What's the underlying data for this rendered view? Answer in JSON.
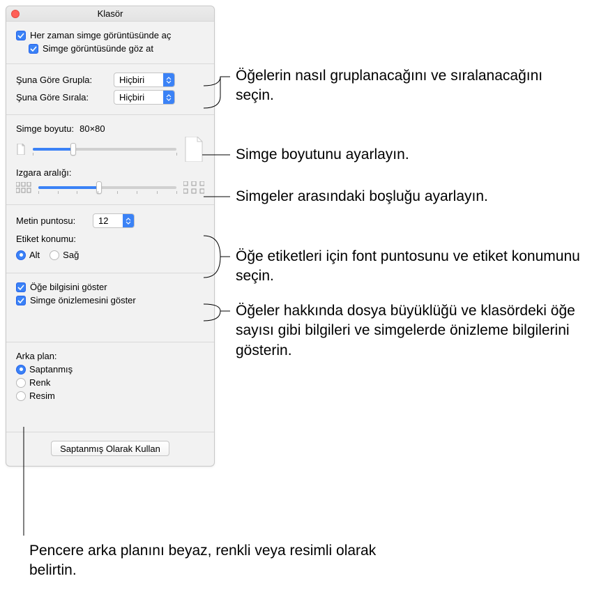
{
  "window": {
    "title": "Klasör"
  },
  "top": {
    "always_icon_view": "Her zaman simge görüntüsünde aç",
    "browse_icon_view": "Simge görüntüsünde göz at"
  },
  "group": {
    "group_by_label": "Şuna Göre Grupla:",
    "group_by_value": "Hiçbiri",
    "sort_by_label": "Şuna Göre Sırala:",
    "sort_by_value": "Hiçbiri"
  },
  "size": {
    "icon_size_label": "Simge boyutu:",
    "icon_size_value": "80×80",
    "grid_spacing_label": "Izgara aralığı:"
  },
  "text": {
    "text_size_label": "Metin puntosu:",
    "text_size_value": "12",
    "label_pos_label": "Etiket konumu:",
    "pos_bottom": "Alt",
    "pos_right": "Sağ"
  },
  "info": {
    "show_item_info": "Öğe bilgisini göster",
    "show_icon_preview": "Simge önizlemesini göster"
  },
  "bg": {
    "label": "Arka plan:",
    "default": "Saptanmış",
    "color": "Renk",
    "picture": "Resim"
  },
  "footer": {
    "button": "Saptanmış Olarak Kullan"
  },
  "callouts": {
    "group": "Öğelerin nasıl gruplanacağını ve sıralanacağını seçin.",
    "icon_size": "Simge boyutunu ayarlayın.",
    "grid": "Simgeler arasındaki boşluğu ayarlayın.",
    "text": "Öğe etiketleri için font puntosunu ve etiket konumunu seçin.",
    "info": "Öğeler hakkında dosya büyüklüğü ve klasördeki öğe sayısı gibi bilgileri ve simgelerde önizleme bilgilerini gösterin.",
    "bg": "Pencere arka planını beyaz, renkli veya resimli olarak belirtin."
  }
}
